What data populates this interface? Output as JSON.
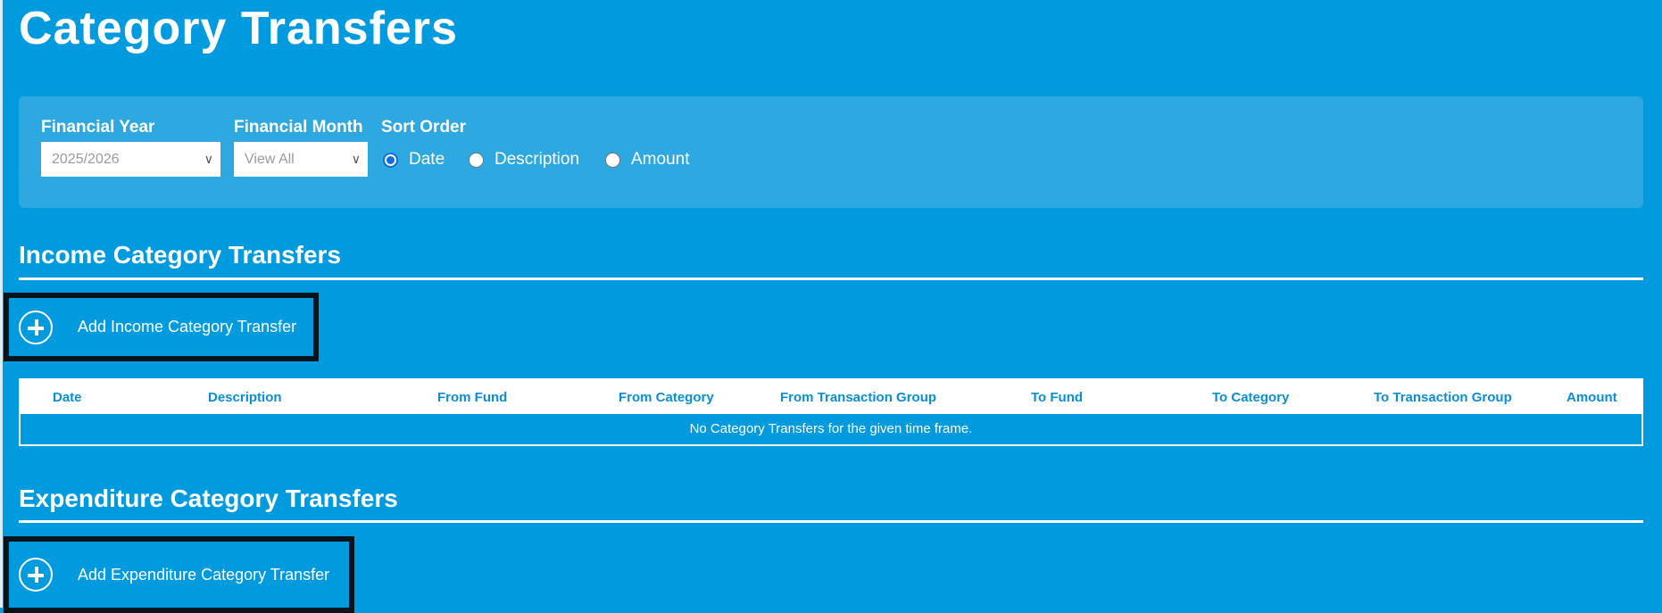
{
  "page": {
    "title": "Category Transfers"
  },
  "filters": {
    "financial_year": {
      "label": "Financial Year",
      "value": "2025/2026"
    },
    "financial_month": {
      "label": "Financial Month",
      "value": "View All"
    },
    "sort_order": {
      "label": "Sort Order",
      "options": [
        "Date",
        "Description",
        "Amount"
      ],
      "selected": "Date"
    }
  },
  "income": {
    "heading": "Income Category Transfers",
    "add_label": "Add Income Category Transfer",
    "columns": [
      "Date",
      "Description",
      "From Fund",
      "From Category",
      "From Transaction Group",
      "To Fund",
      "To Category",
      "To Transaction Group",
      "Amount"
    ],
    "empty_message": "No Category Transfers for the given time frame."
  },
  "expenditure": {
    "heading": "Expenditure Category Transfers",
    "add_label": "Add Expenditure Category Transfer"
  },
  "colors": {
    "background": "#009bdf",
    "panel": "#2ea8e0",
    "header_text": "#0a8fd4",
    "button_border": "#04131c"
  }
}
